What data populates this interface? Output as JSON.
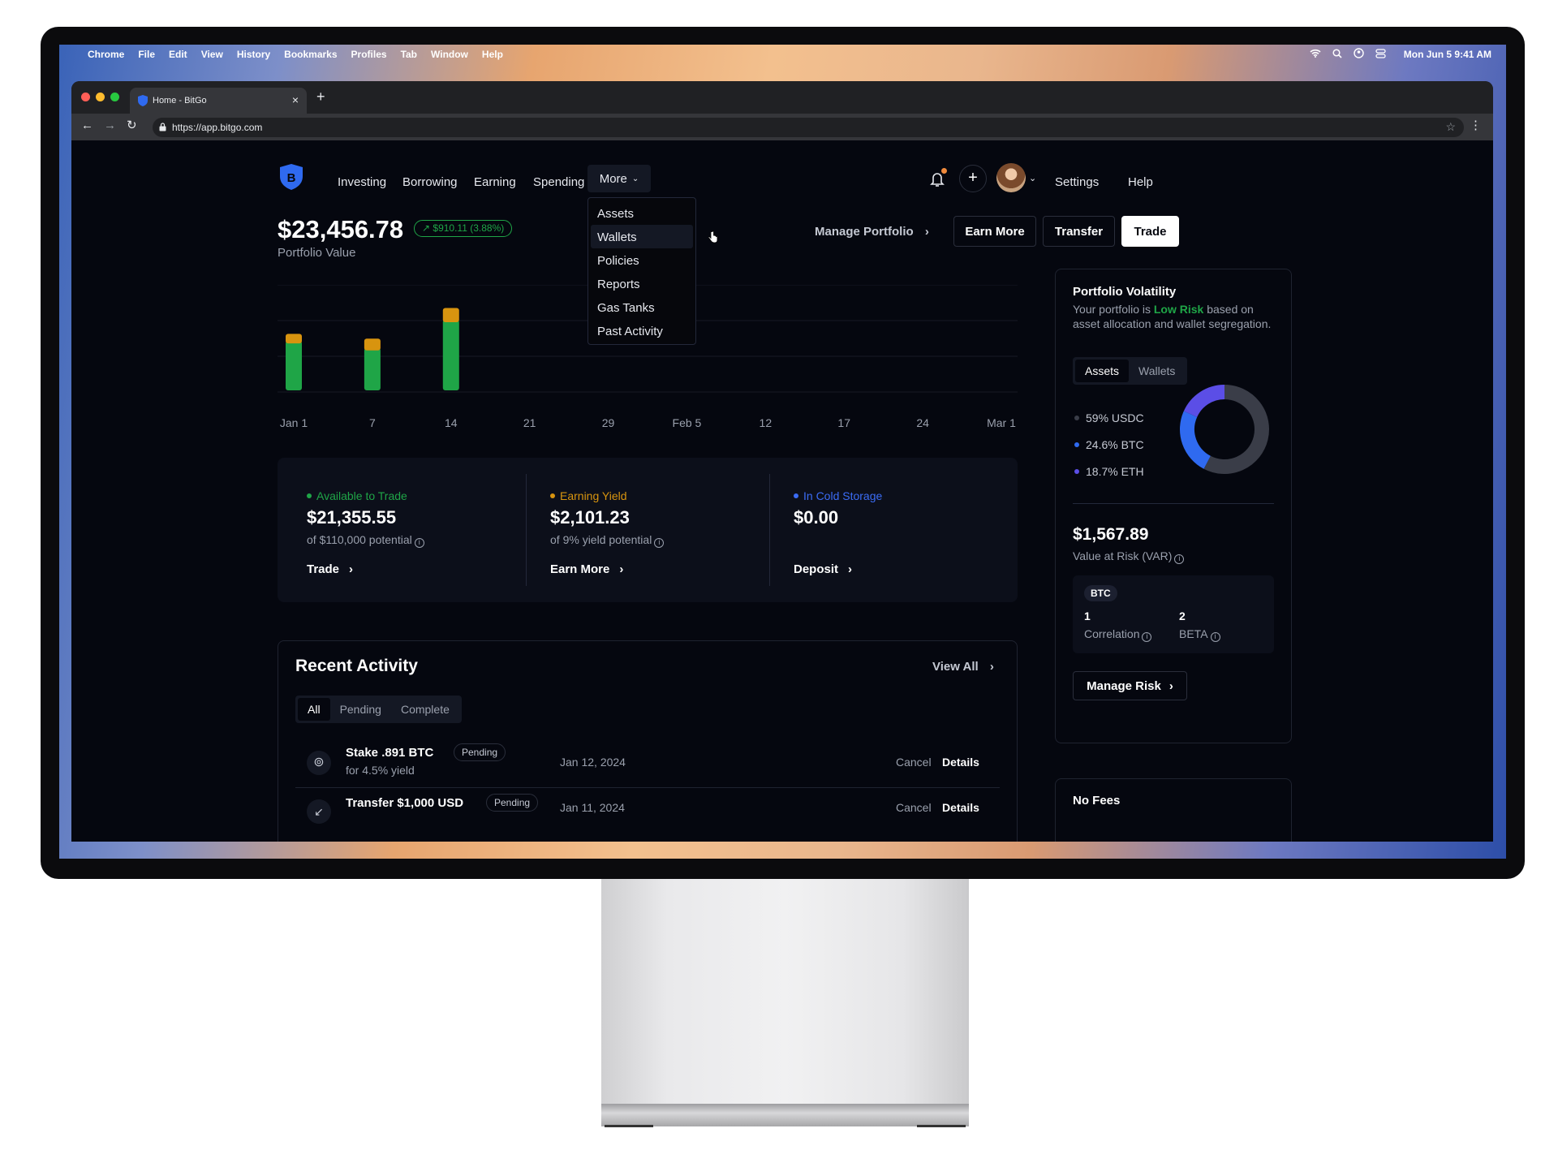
{
  "menubar": {
    "apple": "",
    "items": [
      "Chrome",
      "File",
      "Edit",
      "View",
      "History",
      "Bookmarks",
      "Profiles",
      "Tab",
      "Window",
      "Help"
    ],
    "clock": "Mon Jun 5  9:41 AM"
  },
  "browser": {
    "tab_title": "Home - BitGo",
    "url": "https://app.bitgo.com"
  },
  "nav": {
    "items": [
      "Investing",
      "Borrowing",
      "Earning",
      "Spending"
    ],
    "more": "More",
    "settings": "Settings",
    "help": "Help"
  },
  "dropdown": {
    "items": [
      "Assets",
      "Wallets",
      "Policies",
      "Reports",
      "Gas Tanks",
      "Past Activity"
    ],
    "hovered": "Wallets"
  },
  "portfolio": {
    "value": "$23,456.78",
    "change": "$910.11 (3.88%)",
    "label": "Portfolio Value",
    "manage": "Manage Portfolio"
  },
  "actions": {
    "earn_more": "Earn More",
    "transfer": "Transfer",
    "trade": "Trade"
  },
  "chart_data": {
    "type": "bar",
    "categories": [
      "Jan 1",
      "7",
      "14",
      "21",
      "29",
      "Feb 5",
      "12",
      "17",
      "24",
      "Mar 1"
    ],
    "series": [
      {
        "values": [
          42,
          36,
          60,
          0,
          0,
          0,
          0,
          0,
          0,
          0
        ],
        "color": "#1fa547"
      },
      {
        "values": [
          6,
          8,
          10,
          0,
          0,
          0,
          0,
          0,
          0,
          0
        ],
        "color": "#d8940f"
      }
    ]
  },
  "stats": [
    {
      "label": "Available to Trade",
      "value": "$21,355.55",
      "sub": "of $110,000 potential",
      "link": "Trade",
      "color": "#1fa547"
    },
    {
      "label": "Earning Yield",
      "value": "$2,101.23",
      "sub": "of 9% yield potential",
      "link": "Earn More",
      "color": "#d8940f"
    },
    {
      "label": "In Cold Storage",
      "value": "$0.00",
      "sub": "",
      "link": "Deposit",
      "color": "#3b6cf5"
    }
  ],
  "activity": {
    "title": "Recent Activity",
    "view_all": "View All",
    "tabs": [
      "All",
      "Pending",
      "Complete"
    ],
    "rows": [
      {
        "title": "Stake .891 BTC",
        "badge": "Pending",
        "sub": "for 4.5% yield",
        "date": "Jan 12, 2024",
        "cancel": "Cancel",
        "details": "Details"
      },
      {
        "title": "Transfer $1,000 USD",
        "badge": "Pending",
        "sub": "",
        "date": "Jan 11, 2024",
        "cancel": "Cancel",
        "details": "Details"
      }
    ]
  },
  "volatility": {
    "title": "Portfolio Volatility",
    "desc_pre": "Your portfolio is",
    "risk": "Low Risk",
    "desc_post": "based on asset allocation and wallet segregation.",
    "tabs": [
      "Assets",
      "Wallets"
    ],
    "legend": [
      {
        "label": "59% USDC",
        "color": "#3a3d48"
      },
      {
        "label": "24.6% BTC",
        "color": "#2f6af0"
      },
      {
        "label": "18.7% ETH",
        "color": "#5b4ee6"
      }
    ],
    "donut": [
      59,
      24.6,
      18.7
    ],
    "var_value": "$1,567.89",
    "var_label": "Value at Risk (VAR)",
    "asset_badge": "BTC",
    "correlation_value": "1",
    "correlation_label": "Correlation",
    "beta_value": "2",
    "beta_label": "BETA",
    "manage_risk": "Manage Risk"
  },
  "fees": {
    "title": "No Fees"
  }
}
